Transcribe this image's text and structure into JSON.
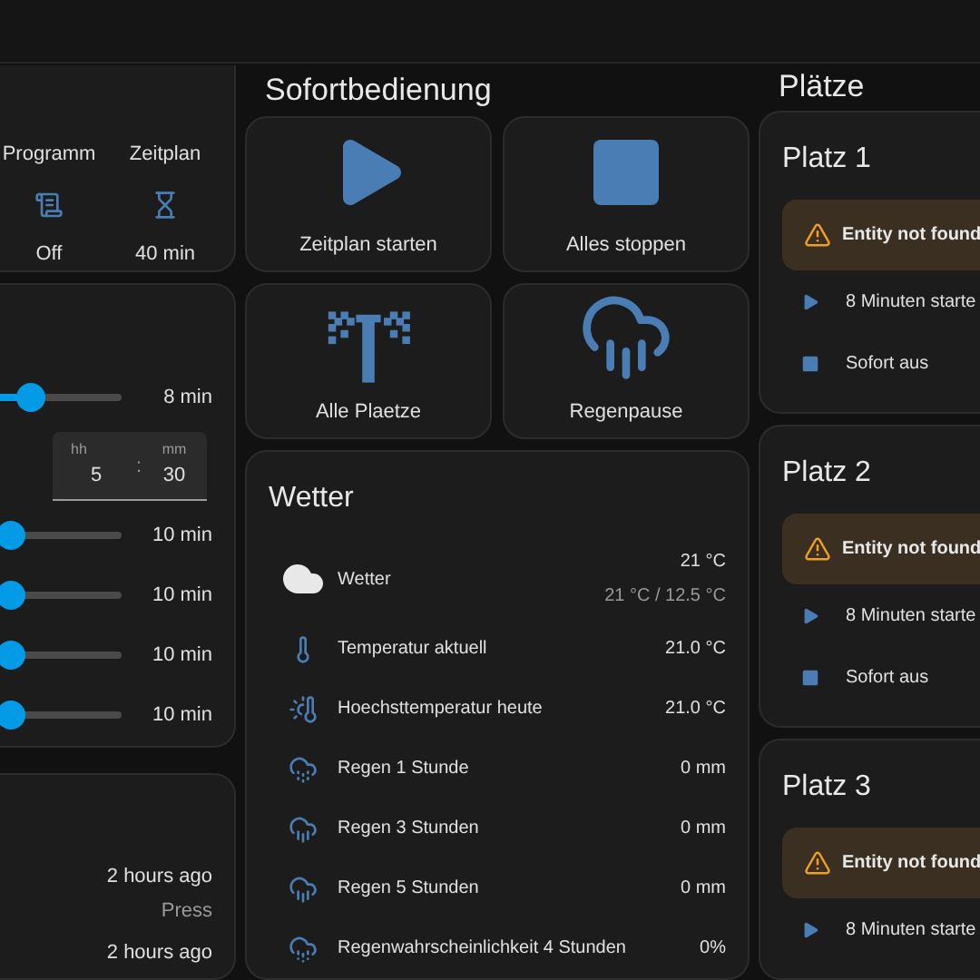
{
  "left": {
    "status": [
      {
        "label": "Programm",
        "kind": "script",
        "value": "Off"
      },
      {
        "label": "Zeitplan",
        "kind": "timer",
        "value": "40 min"
      }
    ],
    "first_slider": {
      "level": 0.47,
      "reading": "8 min"
    },
    "time": {
      "hh_label": "hh",
      "mm_label": "mm",
      "hours": "5",
      "separator": ":",
      "minutes": "30"
    },
    "sliders": [
      {
        "level": 0.35,
        "reading": "10 min"
      },
      {
        "level": 0.35,
        "reading": "10 min"
      },
      {
        "level": 0.35,
        "reading": "10 min"
      },
      {
        "level": 0.35,
        "reading": "10 min"
      }
    ],
    "log": [
      {
        "time": "2 hours ago",
        "action": "Press"
      },
      {
        "time": "2 hours ago"
      }
    ]
  },
  "quick": {
    "title": "Sofortbedienung",
    "buttons": [
      {
        "kind": "play",
        "label": "Zeitplan starten"
      },
      {
        "kind": "stop",
        "label": "Alles stoppen"
      },
      {
        "kind": "sprinkler",
        "label": "Alle Plaetze"
      },
      {
        "kind": "rain",
        "label": "Regenpause"
      }
    ]
  },
  "weather": {
    "title": "Wetter",
    "rows": [
      {
        "kind": "cloud",
        "label": "Wetter",
        "value": "21 °C",
        "secondary": "21 °C / 12.5 °C"
      },
      {
        "kind": "thermometer",
        "label": "Temperatur aktuell",
        "value": "21.0 °C"
      },
      {
        "kind": "thermometer-up",
        "label": "Hoechsttemperatur heute",
        "value": "21.0 °C"
      },
      {
        "kind": "rain-drop",
        "label": "Regen 1 Stunde",
        "value": "0 mm"
      },
      {
        "kind": "rain",
        "label": "Regen 3 Stunden",
        "value": "0 mm"
      },
      {
        "kind": "rain",
        "label": "Regen 5 Stunden",
        "value": "0 mm"
      },
      {
        "kind": "rain-chance",
        "label": "Regenwahrscheinlichkeit 4 Stunden",
        "value": "0%"
      }
    ]
  },
  "places": {
    "title": "Plätze",
    "items": [
      {
        "name": "Platz 1",
        "warning": "Entity not found",
        "actions": [
          {
            "kind": "play",
            "label": "8 Minuten starte"
          },
          {
            "kind": "stop",
            "label": "Sofort aus"
          }
        ]
      },
      {
        "name": "Platz 2",
        "warning": "Entity not found",
        "actions": [
          {
            "kind": "play",
            "label": "8 Minuten starte"
          },
          {
            "kind": "stop",
            "label": "Sofort aus"
          }
        ]
      },
      {
        "name": "Platz 3",
        "warning": "Entity not found",
        "actions": [
          {
            "kind": "play",
            "label": "8 Minuten starte"
          }
        ]
      }
    ]
  }
}
